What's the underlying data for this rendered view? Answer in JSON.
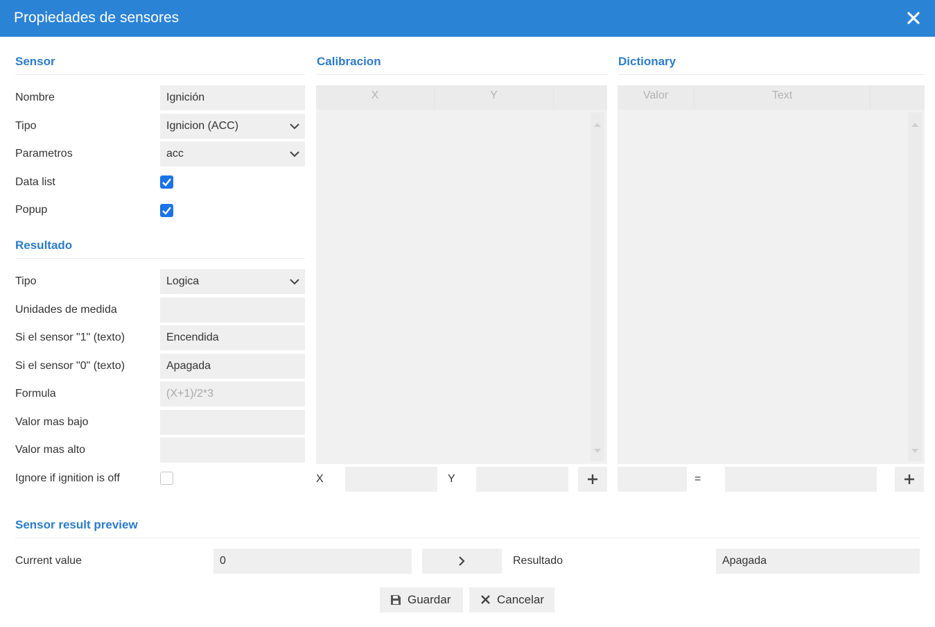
{
  "window": {
    "title": "Propiedades de sensores"
  },
  "icons": {
    "close": "close-icon",
    "save": "floppy-disk-icon",
    "cancel": "x-icon",
    "add": "plus-icon",
    "next": "chevron-right-icon",
    "dropdown": "chevron-down-icon"
  },
  "colors": {
    "titlebar": "#2b83d6",
    "section_title": "#2b7cc9",
    "checkbox_on": "#1a73e8",
    "field_bg": "#efefef"
  },
  "sensor": {
    "heading": "Sensor",
    "name_label": "Nombre",
    "name_value": "Ignición",
    "type_label": "Tipo",
    "type_value": "Ignicion (ACC)",
    "params_label": "Parametros",
    "params_value": "acc",
    "datalist_label": "Data list",
    "datalist_checked": true,
    "popup_label": "Popup",
    "popup_checked": true
  },
  "result": {
    "heading": "Resultado",
    "type_label": "Tipo",
    "type_value": "Logica",
    "units_label": "Unidades de medida",
    "units_value": "",
    "on_label": "Si el sensor \"1\" (texto)",
    "on_value": "Encendida",
    "off_label": "Si el sensor \"0\" (texto)",
    "off_value": "Apagada",
    "formula_label": "Formula",
    "formula_placeholder": "(X+1)/2*3",
    "min_label": "Valor mas bajo",
    "min_value": "",
    "max_label": "Valor mas alto",
    "max_value": "",
    "ignore_label": "Ignore if ignition is off",
    "ignore_checked": false
  },
  "calibration": {
    "heading": "Calibracion",
    "columns": [
      "X",
      "Y",
      ""
    ],
    "x_label": "X",
    "y_label": "Y"
  },
  "dictionary": {
    "heading": "Dictionary",
    "columns": [
      "Valor",
      "Text",
      ""
    ],
    "equals": "="
  },
  "preview": {
    "heading": "Sensor result preview",
    "current_label": "Current value",
    "current_value": "0",
    "result_label": "Resultado",
    "result_value": "Apagada"
  },
  "actions": {
    "save_label": "Guardar",
    "cancel_label": "Cancelar"
  }
}
